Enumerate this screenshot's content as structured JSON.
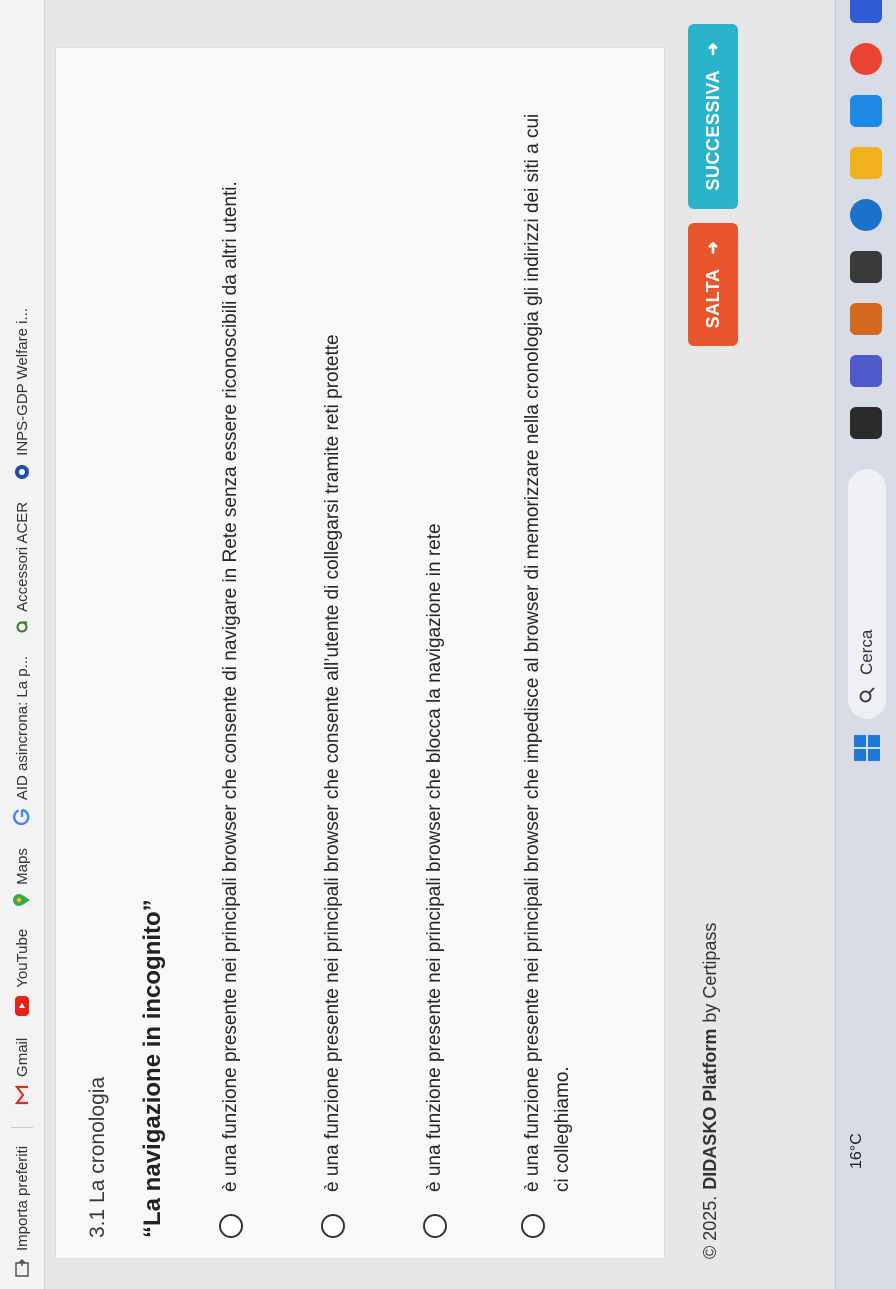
{
  "bookmarks": {
    "items": [
      {
        "label": "Importa preferiti",
        "icon": "import-icon"
      },
      {
        "label": "Gmail",
        "icon": "gmail-icon"
      },
      {
        "label": "YouTube",
        "icon": "youtube-icon"
      },
      {
        "label": "Maps",
        "icon": "maps-icon"
      },
      {
        "label": "AID asincrona: La p...",
        "icon": "google-icon"
      },
      {
        "label": "Accessori ACER",
        "icon": "acer-icon"
      },
      {
        "label": "INPS-GDP Welfare i...",
        "icon": "inps-icon"
      }
    ]
  },
  "quiz": {
    "section_title": "3.1 La cronologia",
    "question": "“La navigazione in incognito”",
    "options": [
      "è una funzione presente nei principali browser che consente di navigare in Rete senza essere riconoscibili da altri utenti.",
      "è una funzione presente nei principali browser che consente all’utente di collegarsi tramite reti protette",
      "è una funzione presente nei principali browser che blocca la navigazione in rete",
      "è una funzione presente nei principali browser che impedisce al browser di memorizzare nella cronologia gli indirizzi dei siti a cui ci colleghiamo."
    ]
  },
  "footer": {
    "copyright": "© 2025.",
    "brand": "DIDASKO Platform",
    "by": "by Certipass"
  },
  "buttons": {
    "skip": "SALTA",
    "next": "SUCCESSIVA"
  },
  "taskbar": {
    "weather": "16°C",
    "search_placeholder": "Cerca"
  },
  "colors": {
    "skip_button": "#e8552c",
    "next_button": "#2bb3c9"
  }
}
